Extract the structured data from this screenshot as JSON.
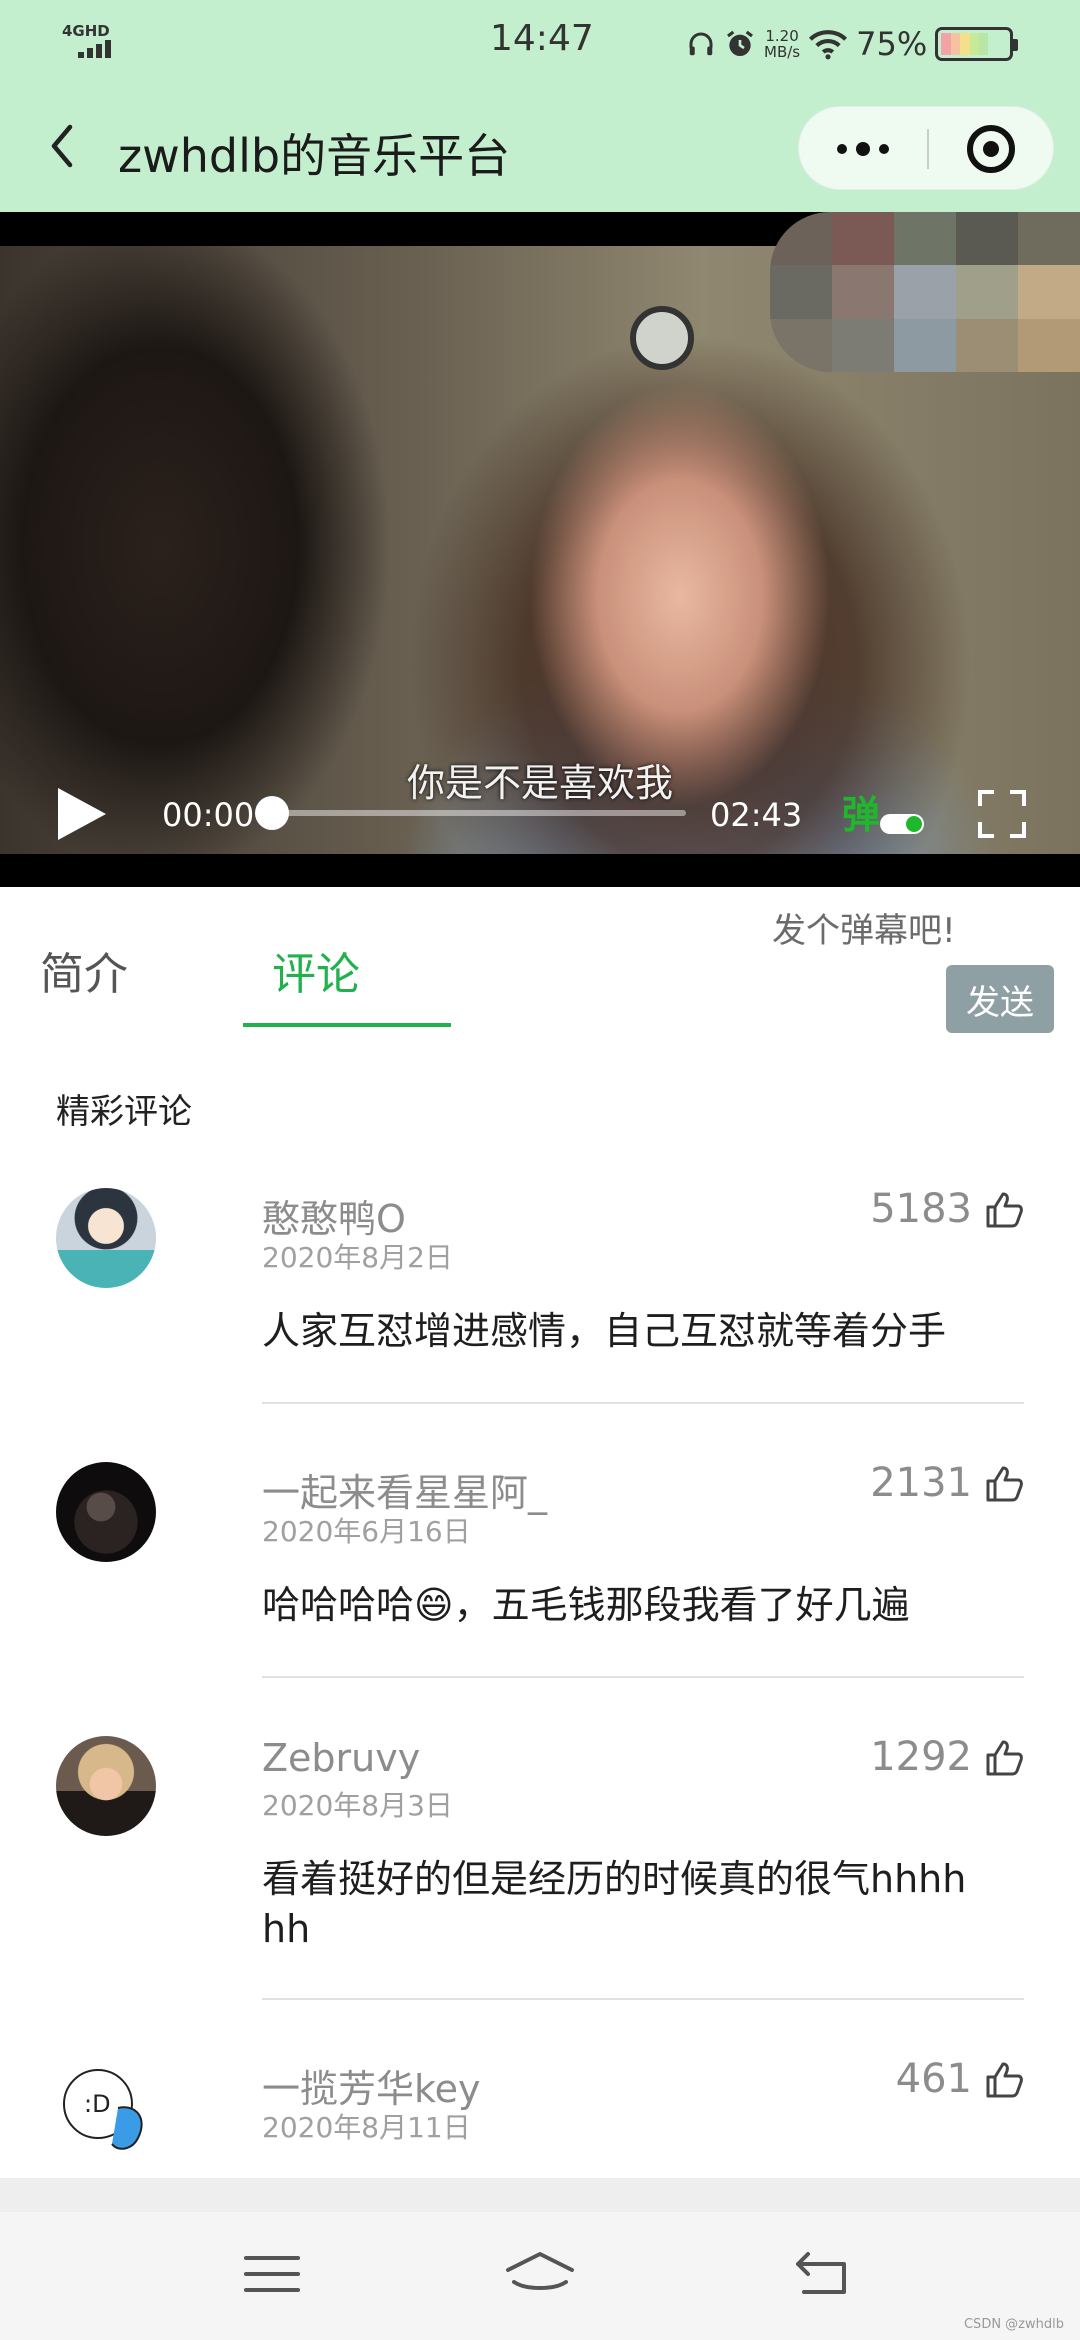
{
  "status_bar": {
    "network": "4GHD",
    "time": "14:47",
    "speed_value": "1.20",
    "speed_unit": "MB/s",
    "battery": "75%",
    "battery_level": 0.75
  },
  "title_bar": {
    "title": "zwhdlb的音乐平台"
  },
  "video": {
    "subtitle": "你是不是喜欢我",
    "current_time": "00:00",
    "total_time": "02:43",
    "progress": 0,
    "danmu_label": "弹",
    "danmu_enabled": true
  },
  "tabs": [
    {
      "label": "简介",
      "active": false
    },
    {
      "label": "评论",
      "active": true
    }
  ],
  "danmu_input": {
    "placeholder": "发个弹幕吧!",
    "send_label": "发送"
  },
  "comments_section": {
    "title": "精彩评论",
    "items": [
      {
        "name": "憨憨鸭O",
        "date": "2020年8月2日",
        "likes": "5183",
        "text": "人家互怼增进感情，自己互怼就等着分手"
      },
      {
        "name": "一起来看星星阿_",
        "date": "2020年6月16日",
        "likes": "2131",
        "text": "哈哈哈哈😄，五毛钱那段我看了好几遍"
      },
      {
        "name": "Zebruvy",
        "date": "2020年8月3日",
        "likes": "1292",
        "text": "看着挺好的但是经历的时候真的很气hhhhhh"
      },
      {
        "name": "一揽芳华key",
        "date": "2020年8月11日",
        "likes": "461",
        "text": ""
      }
    ]
  },
  "colors": {
    "header_bg": "#c4efce",
    "accent_green": "#22b14c",
    "send_button": "#8fa0a5"
  },
  "watermark": "CSDN @zwhdlb"
}
